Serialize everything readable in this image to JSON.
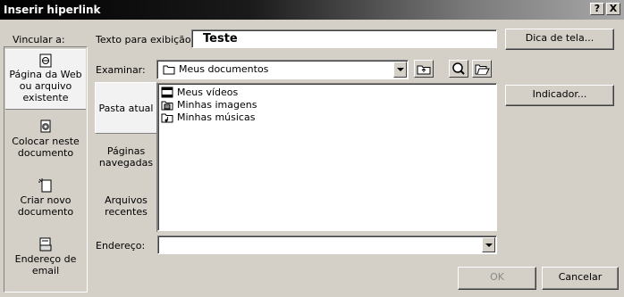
{
  "window": {
    "title": "Inserir hiperlink",
    "help_label": "?",
    "close_label": "X"
  },
  "link_to": {
    "label": "Vincular a:",
    "items": [
      {
        "label": "Página da Web ou arquivo existente",
        "icon": "web-page-icon",
        "selected": true
      },
      {
        "label": "Colocar neste documento",
        "icon": "place-in-document-icon"
      },
      {
        "label": "Criar novo documento",
        "icon": "new-document-icon"
      },
      {
        "label": "Endereço de email",
        "icon": "email-icon"
      }
    ]
  },
  "text_to_display": {
    "label": "Texto para exibição:",
    "value": "Teste"
  },
  "screen_tip_button": "Dica de tela...",
  "look_in": {
    "label": "Examinar:",
    "value": "Meus documentos",
    "icon": "folder-icon"
  },
  "nav": {
    "items": [
      {
        "label": "Pasta atual",
        "selected": true
      },
      {
        "label": "Páginas navegadas"
      },
      {
        "label": "Arquivos recentes"
      }
    ]
  },
  "files": [
    {
      "name": "Meus vídeos",
      "icon": "videos-folder-icon"
    },
    {
      "name": "Minhas imagens",
      "icon": "images-folder-icon"
    },
    {
      "name": "Minhas músicas",
      "icon": "music-folder-icon"
    }
  ],
  "bookmark_button": "Indicador...",
  "address": {
    "label": "Endereço:",
    "value": ""
  },
  "ok_button": "OK",
  "cancel_button": "Cancelar"
}
